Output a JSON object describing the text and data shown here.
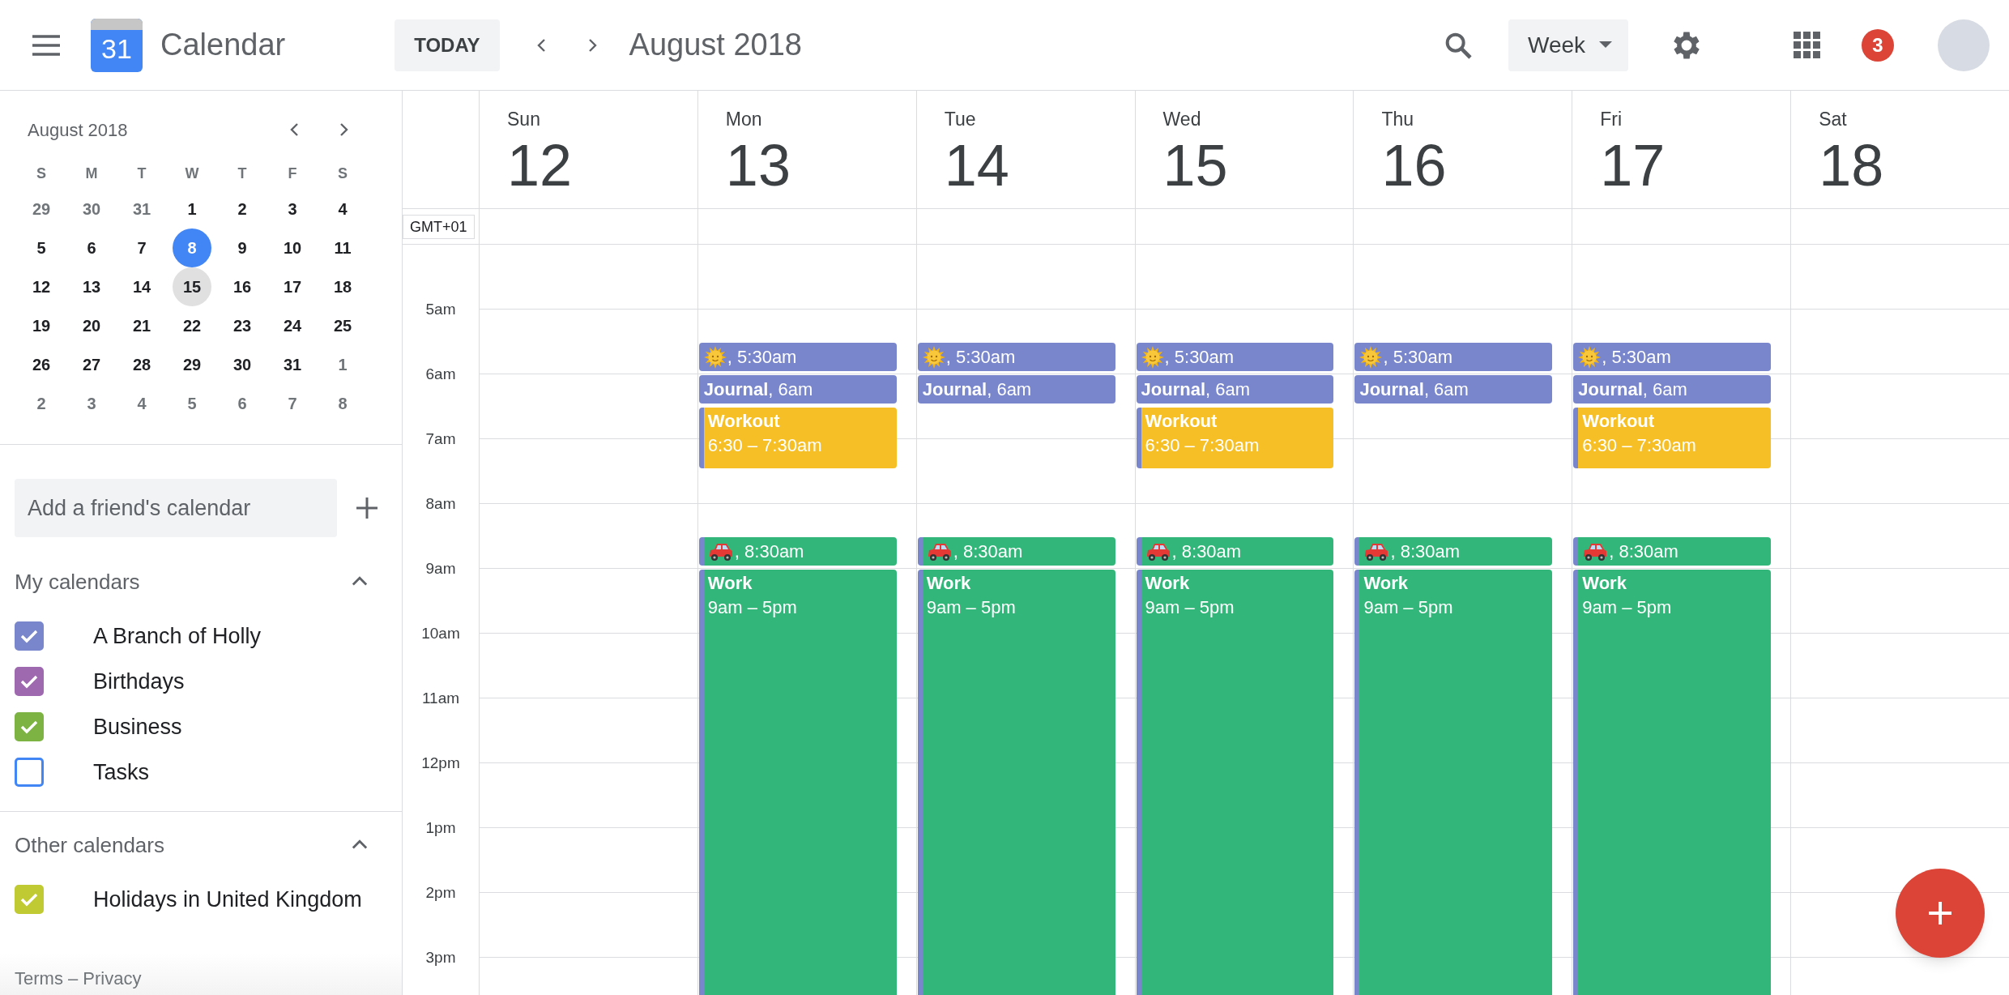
{
  "header": {
    "app_name": "Calendar",
    "logo_number": "31",
    "today_button": "TODAY",
    "period_title": "August 2018",
    "view_select": "Week",
    "notification_count": "3"
  },
  "mini_calendar": {
    "title": "August 2018",
    "weekdays": [
      "S",
      "M",
      "T",
      "W",
      "T",
      "F",
      "S"
    ],
    "days": [
      {
        "label": "29",
        "outside": true,
        "today": false,
        "selected": false
      },
      {
        "label": "30",
        "outside": true,
        "today": false,
        "selected": false
      },
      {
        "label": "31",
        "outside": true,
        "today": false,
        "selected": false
      },
      {
        "label": "1",
        "outside": false,
        "today": false,
        "selected": false
      },
      {
        "label": "2",
        "outside": false,
        "today": false,
        "selected": false
      },
      {
        "label": "3",
        "outside": false,
        "today": false,
        "selected": false
      },
      {
        "label": "4",
        "outside": false,
        "today": false,
        "selected": false
      },
      {
        "label": "5",
        "outside": false,
        "today": false,
        "selected": false
      },
      {
        "label": "6",
        "outside": false,
        "today": false,
        "selected": false
      },
      {
        "label": "7",
        "outside": false,
        "today": false,
        "selected": false
      },
      {
        "label": "8",
        "outside": false,
        "today": true,
        "selected": false
      },
      {
        "label": "9",
        "outside": false,
        "today": false,
        "selected": false
      },
      {
        "label": "10",
        "outside": false,
        "today": false,
        "selected": false
      },
      {
        "label": "11",
        "outside": false,
        "today": false,
        "selected": false
      },
      {
        "label": "12",
        "outside": false,
        "today": false,
        "selected": false
      },
      {
        "label": "13",
        "outside": false,
        "today": false,
        "selected": false
      },
      {
        "label": "14",
        "outside": false,
        "today": false,
        "selected": false
      },
      {
        "label": "15",
        "outside": false,
        "today": false,
        "selected": true
      },
      {
        "label": "16",
        "outside": false,
        "today": false,
        "selected": false
      },
      {
        "label": "17",
        "outside": false,
        "today": false,
        "selected": false
      },
      {
        "label": "18",
        "outside": false,
        "today": false,
        "selected": false
      },
      {
        "label": "19",
        "outside": false,
        "today": false,
        "selected": false
      },
      {
        "label": "20",
        "outside": false,
        "today": false,
        "selected": false
      },
      {
        "label": "21",
        "outside": false,
        "today": false,
        "selected": false
      },
      {
        "label": "22",
        "outside": false,
        "today": false,
        "selected": false
      },
      {
        "label": "23",
        "outside": false,
        "today": false,
        "selected": false
      },
      {
        "label": "24",
        "outside": false,
        "today": false,
        "selected": false
      },
      {
        "label": "25",
        "outside": false,
        "today": false,
        "selected": false
      },
      {
        "label": "26",
        "outside": false,
        "today": false,
        "selected": false
      },
      {
        "label": "27",
        "outside": false,
        "today": false,
        "selected": false
      },
      {
        "label": "28",
        "outside": false,
        "today": false,
        "selected": false
      },
      {
        "label": "29",
        "outside": false,
        "today": false,
        "selected": false
      },
      {
        "label": "30",
        "outside": false,
        "today": false,
        "selected": false
      },
      {
        "label": "31",
        "outside": false,
        "today": false,
        "selected": false
      },
      {
        "label": "1",
        "outside": true,
        "today": false,
        "selected": false
      },
      {
        "label": "2",
        "outside": true,
        "today": false,
        "selected": false
      },
      {
        "label": "3",
        "outside": true,
        "today": false,
        "selected": false
      },
      {
        "label": "4",
        "outside": true,
        "today": false,
        "selected": false
      },
      {
        "label": "5",
        "outside": true,
        "today": false,
        "selected": false
      },
      {
        "label": "6",
        "outside": true,
        "today": false,
        "selected": false
      },
      {
        "label": "7",
        "outside": true,
        "today": false,
        "selected": false
      },
      {
        "label": "8",
        "outside": true,
        "today": false,
        "selected": false
      }
    ]
  },
  "add_calendar": {
    "placeholder": "Add a friend's calendar"
  },
  "calendar_sections": [
    {
      "title": "My calendars",
      "expanded": true,
      "items": [
        {
          "label": "A Branch of Holly",
          "checked": true,
          "color": "#7986cb"
        },
        {
          "label": "Birthdays",
          "checked": true,
          "color": "#9e69af"
        },
        {
          "label": "Business",
          "checked": true,
          "color": "#7cb342"
        },
        {
          "label": "Tasks",
          "checked": false,
          "color": "#4285f4"
        }
      ]
    },
    {
      "title": "Other calendars",
      "expanded": true,
      "items": [
        {
          "label": "Holidays in United Kingdom",
          "checked": true,
          "color": "#c0ca33"
        }
      ]
    }
  ],
  "footer": "Terms – Privacy",
  "timezone": "GMT+01",
  "hours": [
    "5am",
    "6am",
    "7am",
    "8am",
    "9am",
    "10am",
    "11am",
    "12pm",
    "1pm",
    "2pm",
    "3pm"
  ],
  "days": [
    {
      "weekday": "Sun",
      "date": "12"
    },
    {
      "weekday": "Mon",
      "date": "13",
      "events": [
        {
          "kind": "sunrise",
          "text": ", 5:30am"
        },
        {
          "kind": "journal",
          "text": "**Journal**, 6am"
        },
        {
          "kind": "workout",
          "title": "Workout",
          "time": "6:30 – 7:30am"
        },
        {
          "kind": "commute",
          "text": ", 8:30am"
        },
        {
          "kind": "work",
          "title": "Work",
          "time": "9am – 5pm"
        }
      ]
    },
    {
      "weekday": "Tue",
      "date": "14",
      "events": [
        {
          "kind": "sunrise",
          "text": ", 5:30am"
        },
        {
          "kind": "journal",
          "text": "**Journal**, 6am"
        },
        {
          "kind": "commute",
          "text": ", 8:30am"
        },
        {
          "kind": "work",
          "title": "Work",
          "time": "9am – 5pm"
        }
      ]
    },
    {
      "weekday": "Wed",
      "date": "15",
      "events": [
        {
          "kind": "sunrise",
          "text": ", 5:30am"
        },
        {
          "kind": "journal",
          "text": "**Journal**, 6am"
        },
        {
          "kind": "workout",
          "title": "Workout",
          "time": "6:30 – 7:30am"
        },
        {
          "kind": "commute",
          "text": ", 8:30am"
        },
        {
          "kind": "work",
          "title": "Work",
          "time": "9am – 5pm"
        }
      ]
    },
    {
      "weekday": "Thu",
      "date": "16",
      "events": [
        {
          "kind": "sunrise",
          "text": ", 5:30am"
        },
        {
          "kind": "journal",
          "text": "**Journal**, 6am"
        },
        {
          "kind": "commute",
          "text": ", 8:30am"
        },
        {
          "kind": "work",
          "title": "Work",
          "time": "9am – 5pm"
        }
      ]
    },
    {
      "weekday": "Fri",
      "date": "17",
      "events": [
        {
          "kind": "sunrise",
          "text": ", 5:30am"
        },
        {
          "kind": "journal",
          "text": "**Journal**, 6am"
        },
        {
          "kind": "workout",
          "title": "Workout",
          "time": "6:30 – 7:30am"
        },
        {
          "kind": "commute",
          "text": ", 8:30am"
        },
        {
          "kind": "work",
          "title": "Work",
          "time": "9am – 5pm"
        }
      ]
    },
    {
      "weekday": "Sat",
      "date": "18"
    }
  ]
}
